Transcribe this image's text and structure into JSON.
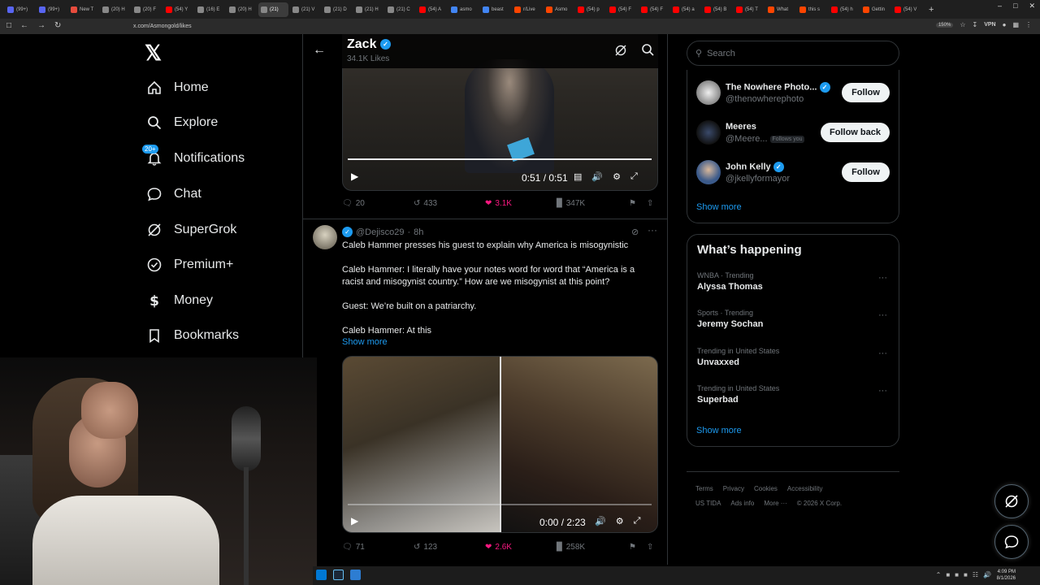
{
  "browser": {
    "tabs": [
      {
        "label": "(99+)",
        "color": "#5865f2"
      },
      {
        "label": "(99+)",
        "color": "#5865f2"
      },
      {
        "label": "New T",
        "color": "#e84c3d"
      },
      {
        "label": "(20) H",
        "color": "#888888"
      },
      {
        "label": "(20) F",
        "color": "#888888"
      },
      {
        "label": "(54) Y",
        "color": "#ff0000"
      },
      {
        "label": "(16) E",
        "color": "#888888"
      },
      {
        "label": "(20) H",
        "color": "#888888"
      },
      {
        "label": "(21)",
        "color": "#888888"
      },
      {
        "label": "(21) V",
        "color": "#888888"
      },
      {
        "label": "(21) D",
        "color": "#888888"
      },
      {
        "label": "(21) H",
        "color": "#888888"
      },
      {
        "label": "(21) C",
        "color": "#888888"
      },
      {
        "label": "(54) A",
        "color": "#ff0000"
      },
      {
        "label": "asmo",
        "color": "#4285f4"
      },
      {
        "label": "beast",
        "color": "#4285f4"
      },
      {
        "label": "r/Live",
        "color": "#ff4500"
      },
      {
        "label": "Asmo",
        "color": "#ff4500"
      },
      {
        "label": "(54) p",
        "color": "#ff0000"
      },
      {
        "label": "(54) F",
        "color": "#ff0000"
      },
      {
        "label": "(54) F",
        "color": "#ff0000"
      },
      {
        "label": "(54) a",
        "color": "#ff0000"
      },
      {
        "label": "(54) B",
        "color": "#ff0000"
      },
      {
        "label": "(54) T",
        "color": "#ff0000"
      },
      {
        "label": "What",
        "color": "#ff4500"
      },
      {
        "label": "this s",
        "color": "#ff4500"
      },
      {
        "label": "(54) h",
        "color": "#ff0000"
      },
      {
        "label": "Gettin",
        "color": "#ff4500"
      },
      {
        "label": "(54) V",
        "color": "#ff0000"
      }
    ],
    "active_tab_index": 8,
    "url": "x.com/Asmongold/likes",
    "zoom": "150%",
    "vpn_label": "VPN"
  },
  "leftnav": {
    "items": [
      {
        "label": "Home",
        "icon": "home-icon"
      },
      {
        "label": "Explore",
        "icon": "search-icon"
      },
      {
        "label": "Notifications",
        "icon": "bell-icon",
        "badge": "20+"
      },
      {
        "label": "Chat",
        "icon": "chat-icon"
      },
      {
        "label": "SuperGrok",
        "icon": "grok-icon"
      },
      {
        "label": "Premium+",
        "icon": "verified-icon"
      },
      {
        "label": "Money",
        "icon": "dollar-icon"
      },
      {
        "label": "Bookmarks",
        "icon": "bookmark-icon"
      }
    ]
  },
  "header": {
    "name": "Zack",
    "likes_count": "34.1K Likes"
  },
  "tweet1": {
    "video_time": "0:51 / 0:51",
    "video_progress": 1.0,
    "replies": "20",
    "reposts": "433",
    "likes": "3.1K",
    "views": "347K"
  },
  "tweet2": {
    "handle": "@Dejisco29",
    "time": "8h",
    "lines": [
      "Caleb Hammer presses his guest to explain why America is misogynistic",
      "Caleb Hammer: I literally have your notes word for word that “America is a",
      "racist and misogynist country.” How are we misogynist at this point?",
      "Guest: We’re built on a patriarchy.",
      "Caleb Hammer: At this"
    ],
    "show_more": "Show more",
    "video_time": "0:00 / 2:23",
    "video_progress": 0.0,
    "replies": "71",
    "reposts": "123",
    "likes": "2.6K",
    "views": "258K"
  },
  "right": {
    "search_placeholder": "Search",
    "follow_suggestions": [
      {
        "name": "The Nowhere Photo...",
        "handle": "@thenowherephoto",
        "verified": true,
        "button": "Follow"
      },
      {
        "name": "Meeres",
        "handle": "@Meere...",
        "follows_you": "Follows you",
        "verified": false,
        "button": "Follow back"
      },
      {
        "name": "John Kelly",
        "handle": "@jkellyformayor",
        "verified": true,
        "button": "Follow"
      }
    ],
    "follow_show_more": "Show more",
    "happening_title": "What’s happening",
    "trends": [
      {
        "context": "WNBA · Trending",
        "name": "Alyssa Thomas"
      },
      {
        "context": "Sports · Trending",
        "name": "Jeremy Sochan"
      },
      {
        "context": "Trending in United States",
        "name": "Unvaxxed"
      },
      {
        "context": "Trending in United States",
        "name": "Superbad"
      }
    ],
    "happening_show_more": "Show more",
    "footer_row1": [
      "Terms",
      "Privacy",
      "Cookies",
      "Accessibility"
    ],
    "footer_row2": [
      "US TIDA",
      "Ads info",
      "More ···",
      "© 2026 X Corp."
    ]
  },
  "taskbar": {
    "time": "4:09 PM",
    "date": "8/1/2026"
  },
  "colors": {
    "accent": "#1d9bf0",
    "like": "#f91880",
    "muted": "#71767b",
    "border": "#2f3336"
  }
}
